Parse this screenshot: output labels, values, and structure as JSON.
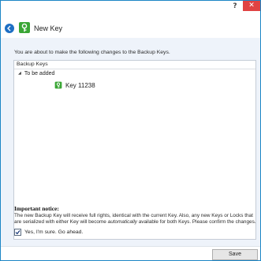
{
  "titlebar": {
    "help_label": "?",
    "close_label": "✕"
  },
  "header": {
    "title": "New Key",
    "back_icon": "back-arrow-icon",
    "title_icon": "key-icon"
  },
  "main": {
    "intro": "You are about to make the following changes to the Backup Keys.",
    "tree": {
      "header": "Backup Keys",
      "group_label": "To be added",
      "items": [
        {
          "label": "Key 11238",
          "icon": "key-icon"
        }
      ]
    }
  },
  "notice": {
    "title": "Important notice:",
    "body_part1": "The new Backup Key will receive full rights, identical with the current Key. Also, any new Keys or Locks that are serialized with either Key will become ",
    "body_em": "automatically",
    "body_part2": " available for both Keys. Please confirm the changes."
  },
  "confirm": {
    "label": "Yes, I'm sure. Go ahead.",
    "checked": true
  },
  "footer": {
    "save_label": "Save"
  },
  "colors": {
    "accent": "#1e6fc4",
    "window_border": "#1c86c6",
    "close": "#e04343",
    "key_green": "#3aa635",
    "content_bg": "#eef3fa"
  }
}
